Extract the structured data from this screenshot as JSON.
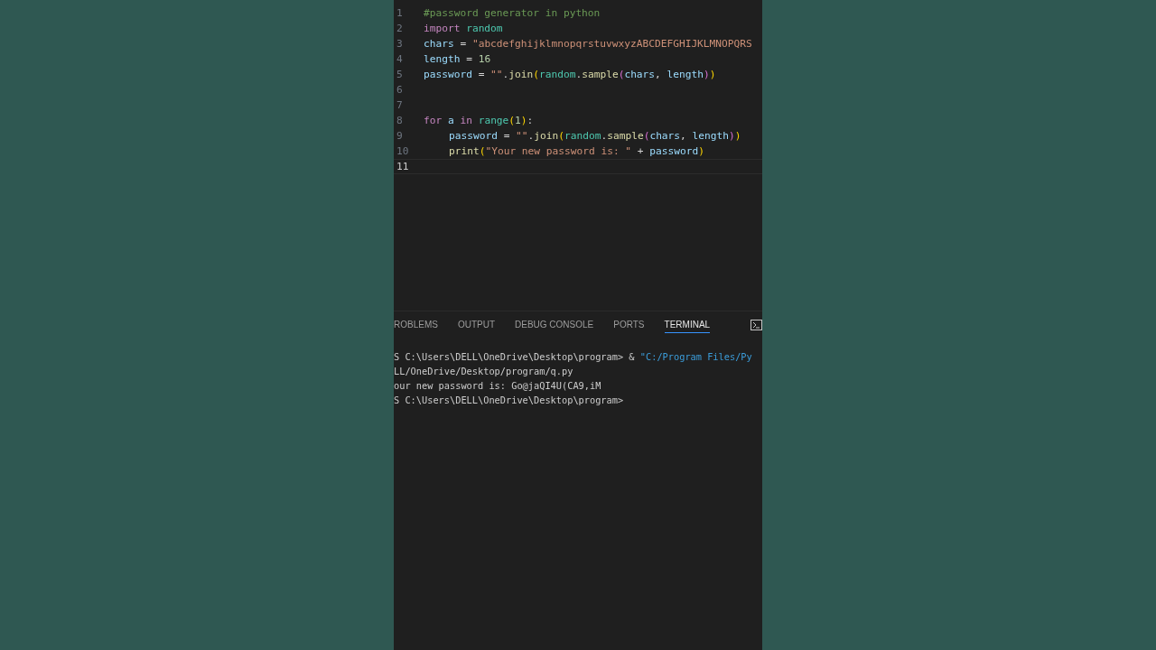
{
  "editor": {
    "lines": [
      {
        "number": "1",
        "tokens": [
          {
            "text": "#password generator in python",
            "kind": "comment"
          }
        ]
      },
      {
        "number": "2",
        "tokens": [
          {
            "text": "import ",
            "kind": "keyword"
          },
          {
            "text": "random",
            "kind": "module"
          }
        ]
      },
      {
        "number": "3",
        "tokens": [
          {
            "text": "chars",
            "kind": "variable"
          },
          {
            "text": " = ",
            "kind": "plain"
          },
          {
            "text": "\"abcdefghijklmnopqrstuvwxyzABCDEFGHIJKLMNOPQRS",
            "kind": "string"
          }
        ]
      },
      {
        "number": "4",
        "tokens": [
          {
            "text": "length",
            "kind": "variable"
          },
          {
            "text": " = ",
            "kind": "plain"
          },
          {
            "text": "16",
            "kind": "number"
          }
        ]
      },
      {
        "number": "5",
        "tokens": [
          {
            "text": "password",
            "kind": "variable"
          },
          {
            "text": " = ",
            "kind": "plain"
          },
          {
            "text": "\"\"",
            "kind": "string"
          },
          {
            "text": ".",
            "kind": "plain"
          },
          {
            "text": "join",
            "kind": "function"
          },
          {
            "text": "(",
            "kind": "bracket"
          },
          {
            "text": "random",
            "kind": "module"
          },
          {
            "text": ".",
            "kind": "plain"
          },
          {
            "text": "sample",
            "kind": "function"
          },
          {
            "text": "(",
            "kind": "bracket2"
          },
          {
            "text": "chars",
            "kind": "variable"
          },
          {
            "text": ", ",
            "kind": "plain"
          },
          {
            "text": "length",
            "kind": "variable"
          },
          {
            "text": ")",
            "kind": "bracket2"
          },
          {
            "text": ")",
            "kind": "bracket"
          }
        ]
      },
      {
        "number": "6"
      },
      {
        "number": "7"
      },
      {
        "number": "8",
        "tokens": [
          {
            "text": "for ",
            "kind": "keyword"
          },
          {
            "text": "a ",
            "kind": "variable"
          },
          {
            "text": "in ",
            "kind": "keyword"
          },
          {
            "text": "range",
            "kind": "module"
          },
          {
            "text": "(",
            "kind": "bracket"
          },
          {
            "text": "1",
            "kind": "number"
          },
          {
            "text": ")",
            "kind": "bracket"
          },
          {
            "text": ":",
            "kind": "plain"
          }
        ]
      },
      {
        "number": "9",
        "indented": true,
        "tokens": [
          {
            "text": "password",
            "kind": "variable"
          },
          {
            "text": " = ",
            "kind": "plain"
          },
          {
            "text": "\"\"",
            "kind": "string"
          },
          {
            "text": ".",
            "kind": "plain"
          },
          {
            "text": "join",
            "kind": "function"
          },
          {
            "text": "(",
            "kind": "bracket"
          },
          {
            "text": "random",
            "kind": "module"
          },
          {
            "text": ".",
            "kind": "plain"
          },
          {
            "text": "sample",
            "kind": "function"
          },
          {
            "text": "(",
            "kind": "bracket2"
          },
          {
            "text": "chars",
            "kind": "variable"
          },
          {
            "text": ", ",
            "kind": "plain"
          },
          {
            "text": "length",
            "kind": "variable"
          },
          {
            "text": ")",
            "kind": "bracket2"
          },
          {
            "text": ")",
            "kind": "bracket"
          }
        ]
      },
      {
        "number": "10",
        "indented": true,
        "tokens": [
          {
            "text": "print",
            "kind": "function"
          },
          {
            "text": "(",
            "kind": "bracket"
          },
          {
            "text": "\"Your new password is: \"",
            "kind": "string"
          },
          {
            "text": " + ",
            "kind": "plain"
          },
          {
            "text": "password",
            "kind": "variable"
          },
          {
            "text": ")",
            "kind": "bracket"
          }
        ]
      },
      {
        "number": "11",
        "current": true
      }
    ]
  },
  "panel": {
    "tabs": [
      {
        "label": "ROBLEMS",
        "selected": false
      },
      {
        "label": "OUTPUT",
        "selected": false
      },
      {
        "label": "DEBUG CONSOLE",
        "selected": false
      },
      {
        "label": "PORTS",
        "selected": false
      },
      {
        "label": "TERMINAL",
        "selected": true
      }
    ],
    "terminal": [
      [
        {
          "text": "S C:\\Users\\DELL\\OneDrive\\Desktop\\program> & ",
          "kind": "plain"
        },
        {
          "text": "\"C:/Program Files/Py",
          "kind": "string"
        }
      ],
      [
        {
          "text": "LL/OneDrive/Desktop/program/q.py",
          "kind": "plain"
        }
      ],
      [
        {
          "text": "our new password is: Go@jaQI4U(CA9,iM",
          "kind": "plain"
        }
      ],
      [
        {
          "text": "S C:\\Users\\DELL\\OneDrive\\Desktop\\program>",
          "kind": "plain"
        }
      ]
    ]
  }
}
